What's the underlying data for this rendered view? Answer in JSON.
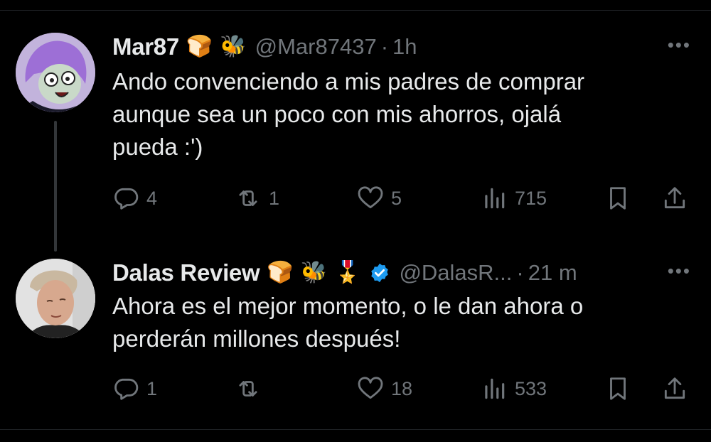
{
  "tweets": [
    {
      "name": "Mar87",
      "emojis": [
        "🍞",
        "🐝"
      ],
      "verified": false,
      "handle": "@Mar87437",
      "separator": "·",
      "time": "1h",
      "more": "•••",
      "text_lines": [
        "Ando convenciendo a mis padres de comprar",
        "aunque sea un poco con mis ahorros, ojalá",
        "pueda :')"
      ],
      "replies": "4",
      "retweets": "1",
      "likes": "5",
      "views": "715"
    },
    {
      "name": "Dalas Review",
      "emojis": [
        "🍞",
        "🐝",
        "🎖️"
      ],
      "verified": true,
      "handle": "@DalasR...",
      "separator": "·",
      "time": "21 m",
      "more": "•••",
      "text_lines": [
        "Ahora es el mejor momento, o le dan ahora o",
        "perderán millones después!"
      ],
      "replies": "1",
      "retweets": "",
      "likes": "18",
      "views": "533"
    }
  ],
  "colors": {
    "background": "#000000",
    "text": "#e7e9ea",
    "muted": "#71767b",
    "verified": "#1d9bf0"
  }
}
